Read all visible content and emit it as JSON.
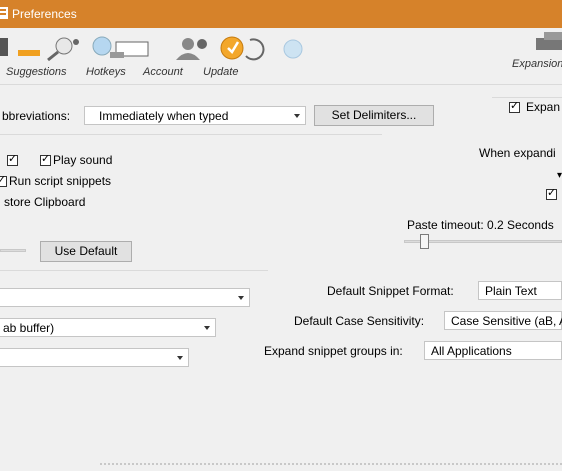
{
  "window": {
    "title": "Preferences"
  },
  "toolbar": {
    "items": [
      {
        "label": "Suggestions",
        "icon": "suggestions-icon"
      },
      {
        "label": "Hotkeys",
        "icon": "hotkeys-icon"
      },
      {
        "label": "Account",
        "icon": "account-icon"
      },
      {
        "label": "Update",
        "icon": "update-icon"
      },
      {
        "label": "Expansion",
        "icon": "expansion-icon"
      }
    ]
  },
  "left": {
    "abbrev_label": "bbreviations:",
    "abbrev_value": "Immediately when typed",
    "set_delimiters": "Set Delimiters...",
    "play_sound": "Play sound",
    "run_script": "Run script snippets",
    "restore_clipboard": "store Clipboard",
    "use_default": "Use Default",
    "combo2_value": "",
    "combo3_value": "ab buffer)",
    "combo4_value": ""
  },
  "right": {
    "expand_label": "Expan",
    "when_expanding": "When expandi",
    "paste_timeout": "Paste timeout: 0.2 Seconds",
    "paste_timeout_fraction": 0.1,
    "default_format_label": "Default Snippet Format:",
    "default_format_value": "Plain Text",
    "case_label": "Default Case Sensitivity:",
    "case_value": "Case Sensitive (aB, A",
    "expand_groups_label": "Expand snippet groups in:",
    "expand_groups_value": "All Applications"
  },
  "colors": {
    "titlebar": "#d6822a",
    "background": "#f0f0f0"
  }
}
